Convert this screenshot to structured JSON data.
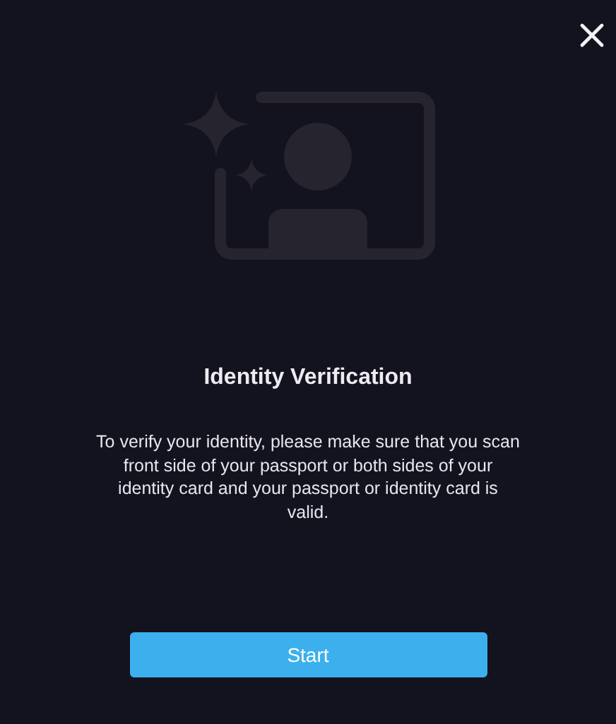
{
  "dialog": {
    "title": "Identity Verification",
    "message": "To verify your identity, please make sure that you scan front side of your passport or both sides of your identity card and your passport or identity card is valid.",
    "button": "Start"
  }
}
